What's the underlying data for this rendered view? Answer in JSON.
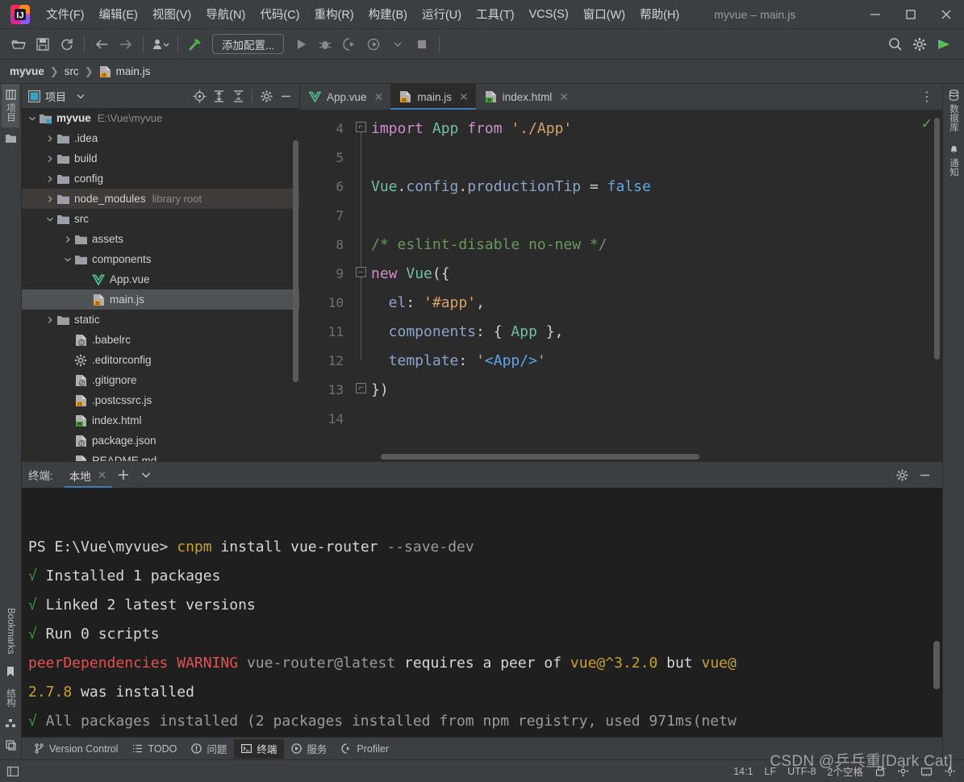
{
  "window": {
    "title": "myvue – main.js",
    "minimize": "—",
    "maximize": "□",
    "close": "✕"
  },
  "menu": {
    "items": [
      {
        "label": "文件(F)",
        "name": "menu-file"
      },
      {
        "label": "编辑(E)",
        "name": "menu-edit"
      },
      {
        "label": "视图(V)",
        "name": "menu-view"
      },
      {
        "label": "导航(N)",
        "name": "menu-navigate"
      },
      {
        "label": "代码(C)",
        "name": "menu-code"
      },
      {
        "label": "重构(R)",
        "name": "menu-refactor"
      },
      {
        "label": "构建(B)",
        "name": "menu-build"
      },
      {
        "label": "运行(U)",
        "name": "menu-run"
      },
      {
        "label": "工具(T)",
        "name": "menu-tools"
      },
      {
        "label": "VCS(S)",
        "name": "menu-vcs"
      },
      {
        "label": "窗口(W)",
        "name": "menu-window"
      },
      {
        "label": "帮助(H)",
        "name": "menu-help"
      }
    ]
  },
  "toolbar": {
    "open_icon": "open-folder-icon",
    "save_icon": "save-icon",
    "sync_icon": "refresh-icon",
    "back_icon": "back-arrow-icon",
    "forward_icon": "forward-arrow-icon",
    "profile_icon": "user-profile-icon",
    "build_icon": "hammer-icon",
    "run_config_label": "添加配置...",
    "run_icon": "run-icon",
    "debug_icon": "debug-icon",
    "coverage_icon": "run-with-coverage-icon",
    "profiler_icon": "profile-icon",
    "stop_icon": "stop-icon",
    "search_icon": "search-icon",
    "settings_icon": "gear-icon",
    "updates_icon": "ide-updates-icon"
  },
  "breadcrumb": {
    "parts": [
      "myvue",
      "src",
      "main.js"
    ],
    "separator": "❯",
    "file_icon": "js-file-icon"
  },
  "left_stripe": {
    "top": [
      {
        "label": "项目",
        "icon": "project-icon",
        "active": true
      }
    ],
    "top_extra_icon": "folder-icon",
    "bottom": [
      {
        "label": "Bookmarks",
        "icon": "bookmark-icon"
      },
      {
        "label": "结构",
        "icon": "structure-icon"
      }
    ],
    "bottom_icon": "layout-icon"
  },
  "right_stripe": {
    "items": [
      {
        "label": "数据库",
        "icon": "database-icon"
      },
      {
        "label": "通知",
        "icon": "bell-icon"
      }
    ]
  },
  "project_panel": {
    "title": "项目",
    "title_icon": "project-window-icon",
    "dropdown_icon": "chevron-down-icon",
    "actions": [
      {
        "name": "locate-icon"
      },
      {
        "name": "expand-all-icon"
      },
      {
        "name": "collapse-all-icon"
      },
      {
        "name": "gear-icon"
      },
      {
        "name": "hide-icon"
      }
    ],
    "tree": [
      {
        "depth": 0,
        "arrow": "expanded",
        "icon": "module-folder-icon",
        "label": "myvue",
        "bold": true,
        "sub": "E:\\Vue\\myvue",
        "state": "normal"
      },
      {
        "depth": 1,
        "arrow": "collapsed",
        "icon": "folder-icon",
        "label": ".idea",
        "sub": "",
        "state": "normal"
      },
      {
        "depth": 1,
        "arrow": "collapsed",
        "icon": "folder-icon",
        "label": "build",
        "sub": "",
        "state": "normal"
      },
      {
        "depth": 1,
        "arrow": "collapsed",
        "icon": "folder-icon",
        "label": "config",
        "sub": "",
        "state": "normal"
      },
      {
        "depth": 1,
        "arrow": "collapsed",
        "icon": "folder-icon",
        "label": "node_modules",
        "sub": "library root",
        "state": "highlight"
      },
      {
        "depth": 1,
        "arrow": "expanded",
        "icon": "folder-icon",
        "label": "src",
        "sub": "",
        "state": "normal"
      },
      {
        "depth": 2,
        "arrow": "collapsed",
        "icon": "folder-icon",
        "label": "assets",
        "sub": "",
        "state": "normal"
      },
      {
        "depth": 2,
        "arrow": "expanded",
        "icon": "folder-icon",
        "label": "components",
        "sub": "",
        "state": "normal"
      },
      {
        "depth": 3,
        "arrow": "none",
        "icon": "vue-file-icon",
        "label": "App.vue",
        "sub": "",
        "state": "normal"
      },
      {
        "depth": 3,
        "arrow": "none",
        "icon": "js-file-icon",
        "label": "main.js",
        "sub": "",
        "state": "selected"
      },
      {
        "depth": 1,
        "arrow": "collapsed",
        "icon": "folder-icon",
        "label": "static",
        "sub": "",
        "state": "normal"
      },
      {
        "depth": 2,
        "arrow": "none",
        "icon": "config-file-icon",
        "label": ".babelrc",
        "sub": "",
        "state": "normal"
      },
      {
        "depth": 2,
        "arrow": "none",
        "icon": "gear-file-icon",
        "label": ".editorconfig",
        "sub": "",
        "state": "normal"
      },
      {
        "depth": 2,
        "arrow": "none",
        "icon": "gitignore-file-icon",
        "label": ".gitignore",
        "sub": "",
        "state": "normal"
      },
      {
        "depth": 2,
        "arrow": "none",
        "icon": "js-file-icon",
        "label": ".postcssrc.js",
        "sub": "",
        "state": "normal"
      },
      {
        "depth": 2,
        "arrow": "none",
        "icon": "html-file-icon",
        "label": "index.html",
        "sub": "",
        "state": "normal"
      },
      {
        "depth": 2,
        "arrow": "none",
        "icon": "config-file-icon",
        "label": "package.json",
        "sub": "",
        "state": "normal"
      },
      {
        "depth": 2,
        "arrow": "none",
        "icon": "md-file-icon",
        "label": "README.md",
        "sub": "",
        "state": "normal"
      }
    ]
  },
  "editor": {
    "tabs": [
      {
        "label": "App.vue",
        "icon": "vue-file-icon",
        "active": false,
        "close": "✕"
      },
      {
        "label": "main.js",
        "icon": "js-file-icon",
        "active": true,
        "close": "✕"
      },
      {
        "label": "index.html",
        "icon": "html-file-icon",
        "active": false,
        "close": "✕"
      }
    ],
    "more_icon": "more-options-icon",
    "inspection_icon": "inspections-ok-icon",
    "line_numbers": [
      "4",
      "5",
      "6",
      "7",
      "8",
      "9",
      "10",
      "11",
      "12",
      "13",
      "14"
    ],
    "lines": [
      {
        "no": "4",
        "tokens": [
          {
            "t": "import ",
            "c": "kw"
          },
          {
            "t": "App ",
            "c": "cls"
          },
          {
            "t": "from ",
            "c": "kw"
          },
          {
            "t": "'./App'",
            "c": "str"
          }
        ]
      },
      {
        "no": "5",
        "tokens": []
      },
      {
        "no": "6",
        "tokens": [
          {
            "t": "Vue",
            "c": "cls"
          },
          {
            "t": ".",
            "c": "punct"
          },
          {
            "t": "config",
            "c": "fn"
          },
          {
            "t": ".",
            "c": "punct"
          },
          {
            "t": "productionTip ",
            "c": "fn"
          },
          {
            "t": "= ",
            "c": "punct"
          },
          {
            "t": "false",
            "c": "num"
          }
        ]
      },
      {
        "no": "7",
        "tokens": []
      },
      {
        "no": "8",
        "tokens": [
          {
            "t": "/* eslint-disable no-new */",
            "c": "cmt"
          }
        ]
      },
      {
        "no": "9",
        "tokens": [
          {
            "t": "new ",
            "c": "kw"
          },
          {
            "t": "Vue",
            "c": "cls"
          },
          {
            "t": "({",
            "c": "punct"
          }
        ]
      },
      {
        "no": "10",
        "tokens": [
          {
            "t": "  el",
            "c": "fn"
          },
          {
            "t": ": ",
            "c": "punct"
          },
          {
            "t": "'#app'",
            "c": "str"
          },
          {
            "t": ",",
            "c": "punct"
          }
        ]
      },
      {
        "no": "11",
        "tokens": [
          {
            "t": "  components",
            "c": "fn"
          },
          {
            "t": ": { ",
            "c": "punct"
          },
          {
            "t": "App",
            "c": "cls"
          },
          {
            "t": " },",
            "c": "punct"
          }
        ]
      },
      {
        "no": "12",
        "tokens": [
          {
            "t": "  template",
            "c": "fn"
          },
          {
            "t": ": ",
            "c": "punct"
          },
          {
            "t": "'",
            "c": "str"
          },
          {
            "t": "<App/>",
            "c": "blue"
          },
          {
            "t": "'",
            "c": "str"
          }
        ]
      },
      {
        "no": "13",
        "tokens": [
          {
            "t": "})",
            "c": "punct"
          }
        ]
      },
      {
        "no": "14",
        "tokens": []
      }
    ]
  },
  "terminal": {
    "label": "终端:",
    "tab_label": "本地",
    "tab_close": "✕",
    "add_icon": "plus-icon",
    "dropdown_icon": "chevron-down-icon",
    "settings_icon": "gear-icon",
    "hide_icon": "hide-icon",
    "lines": [
      [
        {
          "t": "PS E:\\Vue\\myvue> ",
          "c": "t-white"
        },
        {
          "t": "cnpm",
          "c": "t-yellow"
        },
        {
          "t": " install vue-router ",
          "c": "t-white"
        },
        {
          "t": "--save-dev",
          "c": "t-grey"
        }
      ],
      [
        {
          "t": "√",
          "c": "t-green"
        },
        {
          "t": " Installed 1 packages",
          "c": "t-white"
        }
      ],
      [
        {
          "t": "√",
          "c": "t-green"
        },
        {
          "t": " Linked 2 latest versions",
          "c": "t-white"
        }
      ],
      [
        {
          "t": "√",
          "c": "t-green"
        },
        {
          "t": " Run 0 scripts",
          "c": "t-white"
        }
      ],
      [
        {
          "t": "peerDependencies WARNING ",
          "c": "t-red"
        },
        {
          "t": "vue-router@latest",
          "c": "t-grey"
        },
        {
          "t": " requires a peer of ",
          "c": "t-white"
        },
        {
          "t": "vue@^3.2.0",
          "c": "t-yellow"
        },
        {
          "t": " but ",
          "c": "t-white"
        },
        {
          "t": "vue@",
          "c": "t-yellow"
        }
      ],
      [
        {
          "t": "2.7.8",
          "c": "t-yellow"
        },
        {
          "t": " was installed",
          "c": "t-white"
        }
      ],
      [
        {
          "t": "√",
          "c": "t-green"
        },
        {
          "t": " All packages installed (2 packages installed from npm registry, used 971ms(netw",
          "c": "t-grey"
        }
      ]
    ]
  },
  "tool_window_bar": {
    "items": [
      {
        "label": "Version Control",
        "icon": "branch-icon",
        "active": false
      },
      {
        "label": "TODO",
        "icon": "todo-list-icon",
        "active": false
      },
      {
        "label": "问题",
        "icon": "problems-icon",
        "active": false
      },
      {
        "label": "终端",
        "icon": "terminal-icon",
        "active": true
      },
      {
        "label": "服务",
        "icon": "services-icon",
        "active": false
      },
      {
        "label": "Profiler",
        "icon": "profiler-icon",
        "active": false
      }
    ]
  },
  "statusbar": {
    "left_icon": "show-tool-windows-icon",
    "caret_position": "14:1",
    "line_separator": "LF",
    "encoding": "UTF-8",
    "indent": "2个空格",
    "lock_icon": "lock-icon",
    "inspection_icon": "inspection-gear-icon",
    "memory_icon": "memory-icon",
    "background_icon": "background-tasks-icon"
  },
  "watermark": {
    "text": "CSDN @乒乓重[Dark Cat]"
  },
  "colors": {
    "accent_blue": "#3d7bb5",
    "panel_bg": "#3c3f41",
    "editor_bg": "#2b2b2b",
    "terminal_bg": "#1f1f1f",
    "green": "#62a84b",
    "warning_red": "#e05252",
    "yellow": "#c8a030"
  }
}
